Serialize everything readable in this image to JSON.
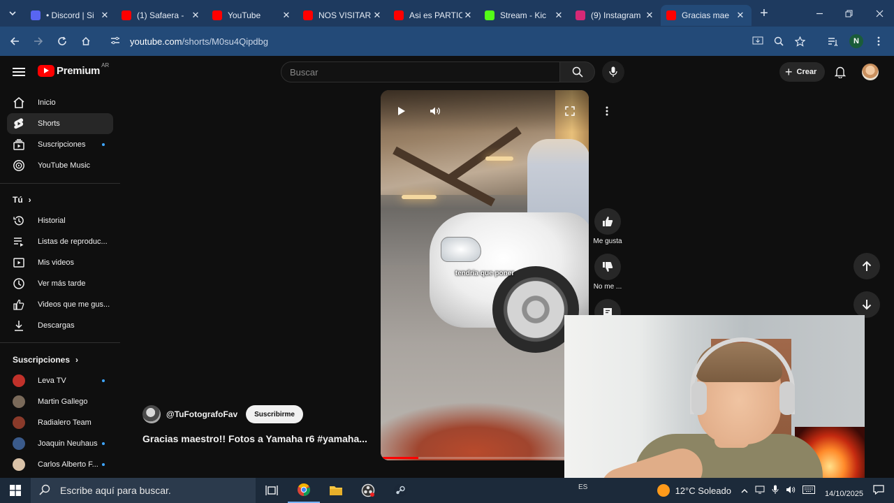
{
  "browser": {
    "tabs": [
      {
        "title": "• Discord | Si",
        "favicon_color": "#5865f2",
        "active": false
      },
      {
        "title": "(1) Safaera -",
        "favicon_color": "#ff0000",
        "active": false
      },
      {
        "title": "YouTube",
        "favicon_color": "#ff0000",
        "active": false
      },
      {
        "title": "NOS VISITAR",
        "favicon_color": "#ff0000",
        "active": false
      },
      {
        "title": "Asi es PARTIC",
        "favicon_color": "#ff0000",
        "active": false
      },
      {
        "title": "Stream - Kic",
        "favicon_color": "#53fc18",
        "active": false
      },
      {
        "title": "(9) Instagram",
        "favicon_color": "#d62976",
        "active": false
      },
      {
        "title": "Gracias mae",
        "favicon_color": "#ff0000",
        "active": true
      }
    ],
    "url_host": "youtube.com",
    "url_path": "/shorts/M0su4Qipdbg",
    "profile_initial": "N"
  },
  "header": {
    "logo_text": "Premium",
    "country_code": "AR",
    "search_placeholder": "Buscar",
    "create_label": "Crear"
  },
  "sidebar": {
    "main": [
      {
        "label": "Inicio",
        "icon": "home-icon",
        "active": false
      },
      {
        "label": "Shorts",
        "icon": "shorts-icon",
        "active": true
      },
      {
        "label": "Suscripciones",
        "icon": "subscriptions-icon",
        "active": false,
        "dot": true
      },
      {
        "label": "YouTube Music",
        "icon": "music-icon",
        "active": false
      }
    ],
    "you_heading": "Tú",
    "you": [
      {
        "label": "Historial",
        "icon": "history-icon"
      },
      {
        "label": "Listas de reproduc...",
        "icon": "playlists-icon"
      },
      {
        "label": "Mis videos",
        "icon": "my-videos-icon"
      },
      {
        "label": "Ver más tarde",
        "icon": "watch-later-icon"
      },
      {
        "label": "Videos que me gus...",
        "icon": "liked-icon"
      },
      {
        "label": "Descargas",
        "icon": "downloads-icon"
      }
    ],
    "subs_heading": "Suscripciones",
    "subs": [
      {
        "label": "Leva TV",
        "color": "#c0312a",
        "dot": true
      },
      {
        "label": "Martin Gallego",
        "color": "#7a6a5a",
        "dot": false
      },
      {
        "label": "Radialero Team",
        "color": "#8a3a2a",
        "dot": false
      },
      {
        "label": "Joaquin Neuhaus",
        "color": "#3a5a8a",
        "dot": true
      },
      {
        "label": "Carlos Alberto F...",
        "color": "#d9c2a8",
        "dot": true
      }
    ]
  },
  "short": {
    "caption": "tendria que poner",
    "channel": "@TuFotografoFav",
    "subscribe_label": "Suscribirme",
    "title": "Gracias maestro!! Fotos a Yamaha r6 #yamaha...",
    "progress": 0.18,
    "like_label": "Me gusta",
    "dislike_label": "No me ..."
  },
  "taskbar": {
    "search_placeholder": "Escribe aquí para buscar.",
    "keyboard_lang": "ES",
    "weather": "12°C  Soleado",
    "date": "14/10/2025"
  }
}
